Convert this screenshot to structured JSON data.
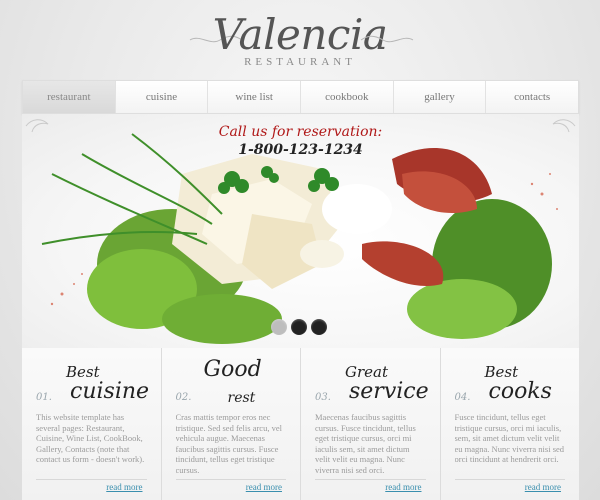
{
  "logo": {
    "name": "Valencia",
    "subtitle": "RESTAURANT"
  },
  "nav": {
    "items": [
      {
        "label": "restaurant",
        "active": true
      },
      {
        "label": "cuisine",
        "active": false
      },
      {
        "label": "wine list",
        "active": false
      },
      {
        "label": "cookbook",
        "active": false
      },
      {
        "label": "gallery",
        "active": false
      },
      {
        "label": "contacts",
        "active": false
      }
    ]
  },
  "banner": {
    "reservation_text": "Call us for reservation:",
    "phone": "1-800-123-1234",
    "slides": 3,
    "active_slide": 3
  },
  "features": [
    {
      "num": "01.",
      "title_small": "Best",
      "title_big": "cuisine",
      "text": "This website template has several pages: Restaurant, Cuisine, Wine List, CookBook, Gallery, Contacts (note that contact us form - doesn't work).",
      "link": "read more"
    },
    {
      "num": "02.",
      "title_small": "Good",
      "title_big": "rest",
      "text": "Cras mattis tempor eros nec tristique. Sed sed felis arcu, vel vehicula augue. Maecenas faucibus sagittis cursus. Fusce tincidunt, tellus eget tristique cursus.",
      "link": "read more"
    },
    {
      "num": "03.",
      "title_small": "Great",
      "title_big": "service",
      "text": "Maecenas faucibus sagittis cursus. Fusce tincidunt, tellus eget tristique cursus, orci mi iaculis sem, sit amet dictum velit velit eu magna. Nunc viverra nisi sed orci.",
      "link": "read more"
    },
    {
      "num": "04.",
      "title_small": "Best",
      "title_big": "cooks",
      "text": "Fusce tincidunt, tellus eget tristique cursus, orci mi iaculis, sem, sit amet dictum velit velit eu magna. Nunc viverra nisi sed orci tincidunt at hendrerit orci.",
      "link": "read more"
    }
  ],
  "colors": {
    "accent_red": "#b01818",
    "link_blue": "#3a8fae",
    "lettuce_green": "#5a9a2a",
    "meat_red": "#a8362a"
  }
}
